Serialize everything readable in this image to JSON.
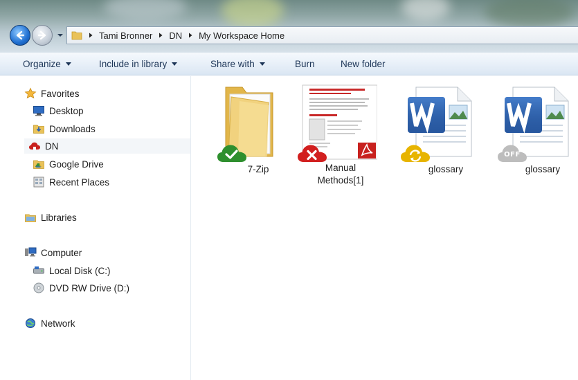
{
  "address": {
    "crumbs": [
      "Tami Bronner",
      "DN",
      "My Workspace Home"
    ]
  },
  "toolbar": {
    "items": [
      {
        "label": "Organize",
        "dropdown": true
      },
      {
        "label": "Include in library",
        "dropdown": true
      },
      {
        "label": "Share with",
        "dropdown": true
      },
      {
        "label": "Burn",
        "dropdown": false
      },
      {
        "label": "New folder",
        "dropdown": false
      }
    ]
  },
  "sidebar": {
    "favorites": {
      "label": "Favorites",
      "items": [
        "Desktop",
        "Downloads",
        "DN",
        "Google Drive",
        "Recent Places"
      ]
    },
    "libraries": {
      "label": "Libraries"
    },
    "computer": {
      "label": "Computer",
      "items": [
        "Local Disk (C:)",
        "DVD RW Drive (D:)"
      ]
    },
    "network": {
      "label": "Network"
    }
  },
  "files": [
    {
      "name": "7-Zip",
      "type": "folder",
      "status": "synced",
      "status_icon": "check-icon",
      "status_color": "#2e8f2e"
    },
    {
      "name": "Manual Methods[1]",
      "type": "pdf",
      "status": "error",
      "status_icon": "x-icon",
      "status_color": "#d21f1f"
    },
    {
      "name": "glossary",
      "type": "word",
      "status": "syncing",
      "status_icon": "sync-icon",
      "status_color": "#e7b400"
    },
    {
      "name": "glossary",
      "type": "word",
      "status": "offline",
      "status_icon": "off-icon",
      "status_text": "OFF",
      "status_color": "#bdbdbd"
    }
  ]
}
